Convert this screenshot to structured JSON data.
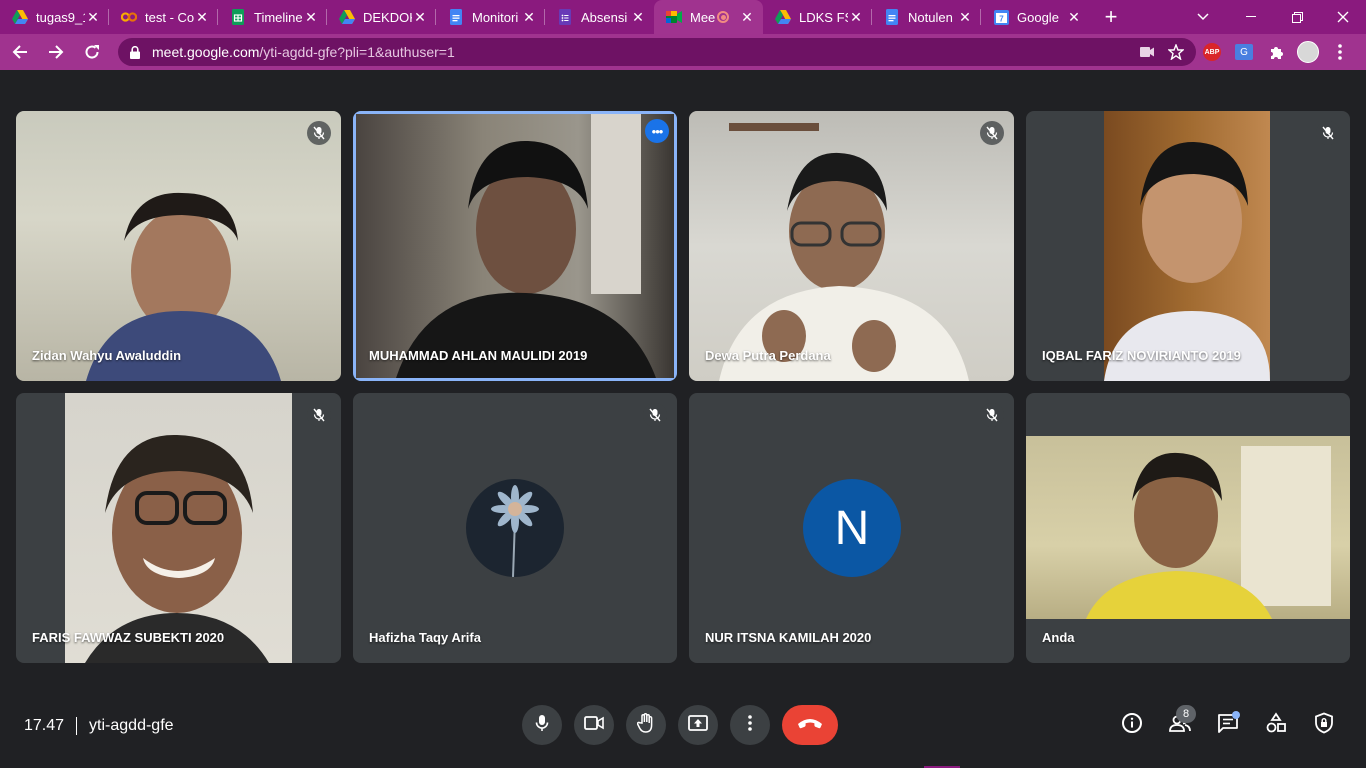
{
  "browser": {
    "tabs": [
      {
        "title": "tugas9_1",
        "icon": "google-drive-icon"
      },
      {
        "title": "test - Co",
        "icon": "colab-icon"
      },
      {
        "title": "Timeline",
        "icon": "google-sheets-icon"
      },
      {
        "title": "DEKDOK",
        "icon": "google-drive-icon"
      },
      {
        "title": "Monitori",
        "icon": "google-docs-icon"
      },
      {
        "title": "Absensi",
        "icon": "google-forms-icon"
      },
      {
        "title": "Mee",
        "icon": "google-meet-icon",
        "active": true
      },
      {
        "title": "LDKS FS",
        "icon": "google-drive-icon"
      },
      {
        "title": "Notulen",
        "icon": "google-docs-icon"
      },
      {
        "title": "Google",
        "icon": "google-calendar-icon"
      }
    ],
    "url_host": "meet.google.com",
    "url_rest": "/yti-agdd-gfe?pli=1&authuser=1",
    "extensions": {
      "abp_label": "ABP",
      "translate_label": "G"
    },
    "colors": {
      "tabbar": "#8a1a7e",
      "toolbar": "#a0338f"
    }
  },
  "meet": {
    "participants": [
      {
        "name": "Zidan Wahyu Awaluddin",
        "muted": true
      },
      {
        "name": "MUHAMMAD AHLAN MAULIDI 2019",
        "muted": false,
        "focused": true
      },
      {
        "name": "Dewa Putra Perdana",
        "muted": true
      },
      {
        "name": "IQBAL FARIZ NOVIRIANTO 2019",
        "muted": true
      },
      {
        "name": "FARIS FAWWAZ SUBEKTI 2020",
        "muted": true
      },
      {
        "name": "Hafizha Taqy Arifa",
        "muted": true
      },
      {
        "name": "NUR ITSNA KAMILAH 2020",
        "muted": true,
        "avatar_letter": "N",
        "avatar_color": "#0b57a4"
      },
      {
        "name": "Anda",
        "muted": false
      }
    ],
    "time": "17.47",
    "meeting_code": "yti-agdd-gfe",
    "people_count": "8",
    "end_call_color": "#ea4335"
  }
}
